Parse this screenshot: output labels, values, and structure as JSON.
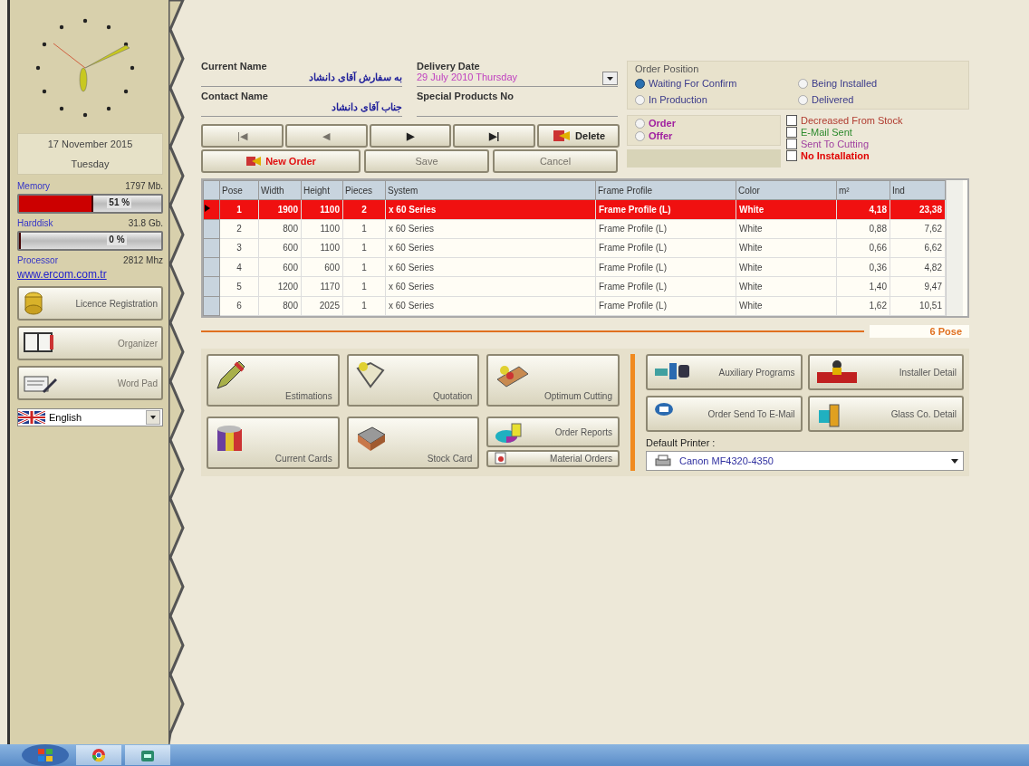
{
  "sidebar": {
    "date": "17 November 2015",
    "day": "Tuesday",
    "memory": {
      "label": "Memory",
      "value": "1797 Mb.",
      "level": 0.51,
      "reading": "51 %"
    },
    "harddisk": {
      "label": "Harddisk",
      "value": "31.8 Gb.",
      "level": 0.0,
      "reading": "0 %"
    },
    "processor": {
      "label": "Processor",
      "value": "2812 Mhz"
    },
    "website": "www.ercom.com.tr",
    "buttons": [
      {
        "label": "Licence Registration",
        "disabled": false
      },
      {
        "label": "Organizer",
        "disabled": true
      },
      {
        "label": "Word Pad",
        "disabled": true
      }
    ],
    "language": "English"
  },
  "order": {
    "current_name": {
      "label": "Current Name",
      "value": "به سفارش آقای دانشاد"
    },
    "contact_name": {
      "label": "Contact Name",
      "value": "جناب آقای دانشاد"
    },
    "delivery_date": {
      "label": "Delivery Date",
      "value": "29 July 2010 Thursday"
    },
    "special_products": {
      "label": "Special Products No"
    },
    "nav_buttons": [
      {
        "label": "|◀",
        "disabled": true
      },
      {
        "label": "◀",
        "disabled": true
      },
      {
        "label": "▶",
        "disabled": false
      },
      {
        "label": "▶|",
        "disabled": false
      },
      {
        "label": "Delete",
        "disabled": false
      }
    ],
    "action_buttons": [
      {
        "label": "New Order",
        "disabled": false
      },
      {
        "label": "Save",
        "disabled": true
      },
      {
        "label": "Cancel",
        "disabled": true
      }
    ]
  },
  "order_position": {
    "title": "Order Position",
    "options": [
      {
        "label": "Waiting For Confirm",
        "selected": true
      },
      {
        "label": "Being Installed",
        "selected": false
      },
      {
        "label": "In Production",
        "selected": false
      },
      {
        "label": "Delivered",
        "selected": false
      }
    ]
  },
  "order_type": [
    {
      "label": "Order",
      "selected": false
    },
    {
      "label": "Offer",
      "selected": false
    }
  ],
  "flags": [
    {
      "label": "Decreased From Stock",
      "checked": false,
      "color": "#b03a2e"
    },
    {
      "label": "E-Mail Sent",
      "checked": false,
      "color": "#2e8b2e"
    },
    {
      "label": "Sent To Cutting",
      "checked": false,
      "color": "#a040a0"
    },
    {
      "label": "No Installation",
      "checked": false,
      "color": "#e00000"
    }
  ],
  "table": {
    "columns": [
      "Pose",
      "Width",
      "Height",
      "Pieces",
      "System",
      "Frame Profile",
      "Color",
      "m²",
      "Ind"
    ],
    "rows": [
      {
        "selected": true,
        "cells": [
          "1",
          "1900",
          "1100",
          "2",
          "x 60 Series",
          "Frame Profile (L)",
          "White",
          "4,18",
          "23,38"
        ]
      },
      {
        "selected": false,
        "cells": [
          "2",
          "800",
          "1100",
          "1",
          "x 60 Series",
          "Frame Profile (L)",
          "White",
          "0,88",
          "7,62"
        ]
      },
      {
        "selected": false,
        "cells": [
          "3",
          "600",
          "1100",
          "1",
          "x 60 Series",
          "Frame Profile (L)",
          "White",
          "0,66",
          "6,62"
        ]
      },
      {
        "selected": false,
        "cells": [
          "4",
          "600",
          "600",
          "1",
          "x 60 Series",
          "Frame Profile (L)",
          "White",
          "0,36",
          "4,82"
        ]
      },
      {
        "selected": false,
        "cells": [
          "5",
          "1200",
          "1170",
          "1",
          "x 60 Series",
          "Frame Profile (L)",
          "White",
          "1,40",
          "9,47"
        ]
      },
      {
        "selected": false,
        "cells": [
          "6",
          "800",
          "2025",
          "1",
          "x 60 Series",
          "Frame Profile (L)",
          "White",
          "1,62",
          "10,51"
        ]
      }
    ],
    "total": "6 Pose"
  },
  "modules": [
    {
      "label": "Estimations"
    },
    {
      "label": "Quotation"
    },
    {
      "label": "Optimum Cutting"
    },
    {
      "label": "Current Cards"
    },
    {
      "label": "Stock Card"
    }
  ],
  "report_buttons": [
    {
      "label": "Order Reports"
    },
    {
      "label": "Material Orders"
    }
  ],
  "tools": [
    {
      "label": "Auxiliary Programs"
    },
    {
      "label": "Installer Detail"
    },
    {
      "label": "Order Send To E-Mail"
    },
    {
      "label": "Glass Co. Detail"
    }
  ],
  "printer": {
    "label": "Default Printer :",
    "value": "Canon MF4320-4350"
  }
}
